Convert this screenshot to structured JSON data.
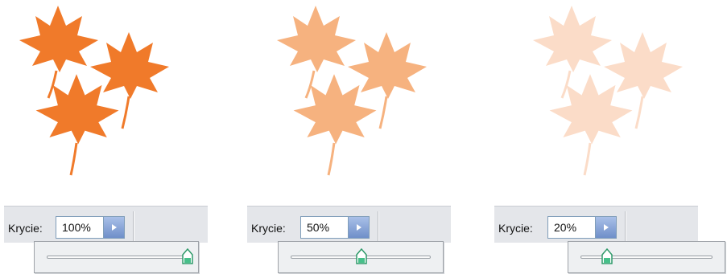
{
  "panels": [
    {
      "opacity_label": "Krycie:",
      "opacity_value": "100%",
      "opacity_fraction": 1.0,
      "leaf_color": "#f07a2a"
    },
    {
      "opacity_label": "Krycie:",
      "opacity_value": "50%",
      "opacity_fraction": 0.5,
      "leaf_color": "#f6b27f"
    },
    {
      "opacity_label": "Krycie:",
      "opacity_value": "20%",
      "opacity_fraction": 0.2,
      "leaf_color": "#fbdcc8"
    }
  ],
  "icons": {
    "leaf": "maple-leaf-icon",
    "arrow": "triangle-right-icon",
    "thumb": "slider-thumb-icon"
  }
}
